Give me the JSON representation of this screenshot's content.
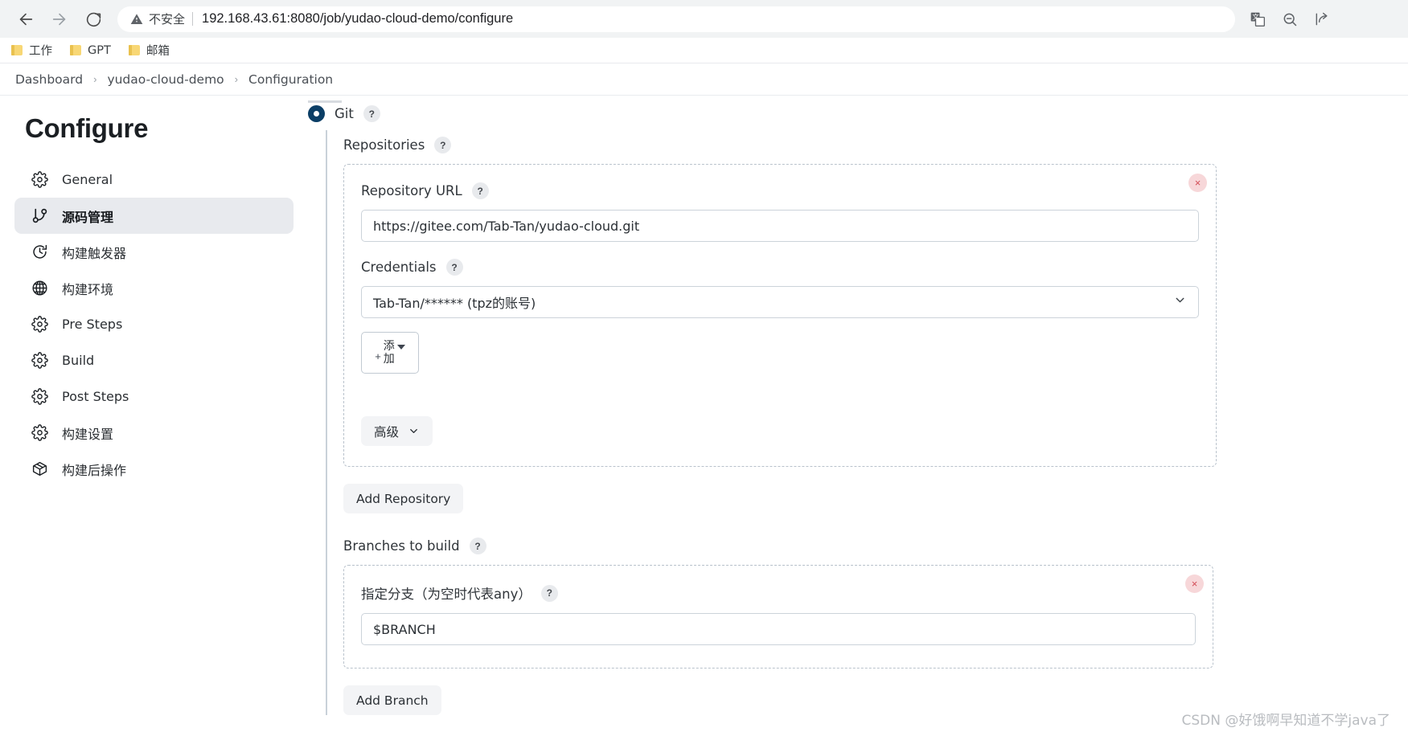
{
  "browser": {
    "back_icon": "back-arrow-icon",
    "forward_icon": "forward-arrow-icon",
    "reload_icon": "reload-icon",
    "security_warning": "不安全",
    "url_host": "192.168.43.61:8080",
    "url_path": "/job/yudao-cloud-demo/configure",
    "url_full": "192.168.43.61:8080/job/yudao-cloud-demo/configure",
    "actions": [
      {
        "name": "translate-icon",
        "label": "翻译"
      },
      {
        "name": "zoom-out-icon",
        "label": "缩小"
      },
      {
        "name": "share-icon",
        "label": "分享"
      }
    ],
    "bookmarks": [
      {
        "label": "工作"
      },
      {
        "label": "GPT"
      },
      {
        "label": "邮箱"
      }
    ]
  },
  "breadcrumb": {
    "items": [
      "Dashboard",
      "yudao-cloud-demo",
      "Configuration"
    ],
    "separator": "›"
  },
  "sidebar": {
    "title": "Configure",
    "items": [
      {
        "label": "General",
        "icon": "gear-icon",
        "active": false
      },
      {
        "label": "源码管理",
        "icon": "git-branch-icon",
        "active": true
      },
      {
        "label": "构建触发器",
        "icon": "clock-icon",
        "active": false
      },
      {
        "label": "构建环境",
        "icon": "globe-icon",
        "active": false
      },
      {
        "label": "Pre Steps",
        "icon": "gear-icon",
        "active": false
      },
      {
        "label": "Build",
        "icon": "gear-icon",
        "active": false
      },
      {
        "label": "Post Steps",
        "icon": "gear-icon",
        "active": false
      },
      {
        "label": "构建设置",
        "icon": "gear-icon",
        "active": false
      },
      {
        "label": "构建后操作",
        "icon": "package-icon",
        "active": false
      }
    ]
  },
  "main": {
    "scm": {
      "radio_label": "Git",
      "radio_selected": true,
      "help": "?"
    },
    "repositories": {
      "label": "Repositories",
      "help": "?",
      "repository_url": {
        "label": "Repository URL",
        "help": "?",
        "value": "https://gitee.com/Tab-Tan/yudao-cloud.git",
        "placeholder": ""
      },
      "credentials": {
        "label": "Credentials",
        "help": "?",
        "value": "Tab-Tan/****** (tpz的账号)",
        "caret_icon": "chevron-down-icon"
      },
      "add_credential_button": {
        "label": "添加",
        "plus": "+",
        "caret_icon": "caret-down-icon"
      },
      "advanced_button": {
        "label": "高级",
        "caret_icon": "chevron-down-icon"
      },
      "delete_button": "×",
      "add_repository_button": "Add Repository"
    },
    "branches": {
      "label": "Branches to build",
      "help": "?",
      "branch_specifier": {
        "label": "指定分支（为空时代表any）",
        "help": "?",
        "value": "$BRANCH",
        "placeholder": ""
      },
      "delete_button": "×",
      "add_branch_button": "Add Branch"
    }
  },
  "watermark": "CSDN @好饿啊早知道不学java了"
}
